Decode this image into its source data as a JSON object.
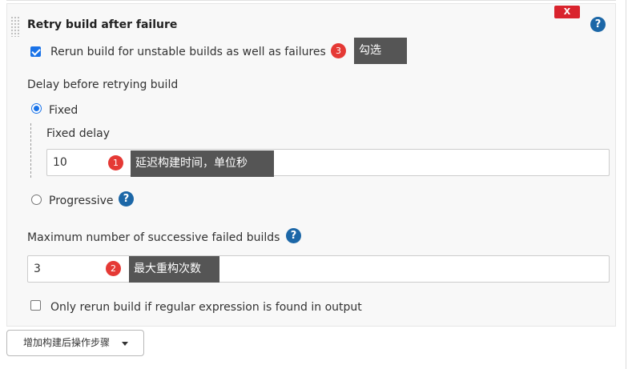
{
  "section": {
    "title": "Retry build after failure",
    "delete_label": "X",
    "help_label": "?"
  },
  "rerun_unstable": {
    "label": "Rerun build for unstable builds as well as failures",
    "checked": true
  },
  "delay": {
    "label": "Delay before retrying build",
    "options": [
      {
        "label": "Fixed",
        "selected": true
      },
      {
        "label": "Progressive",
        "selected": false
      }
    ],
    "fixed_delay_label": "Fixed delay",
    "fixed_delay_value": "10"
  },
  "max_failed": {
    "label": "Maximum number of successive failed builds",
    "value": "3"
  },
  "regex_only": {
    "label": "Only rerun build if regular expression is found in output",
    "checked": false
  },
  "annotations": [
    {
      "number": "1",
      "text": "延迟构建时间，单位秒"
    },
    {
      "number": "2",
      "text": "最大重构次数"
    },
    {
      "number": "3",
      "text": "勾选"
    }
  ],
  "add_post_build_step": {
    "label": "增加构建后操作步骤"
  },
  "colors": {
    "accent": "#1a73e8",
    "help": "#1c67a7",
    "delete": "#d9232d",
    "badge": "#e53935",
    "callout": "#555555"
  }
}
